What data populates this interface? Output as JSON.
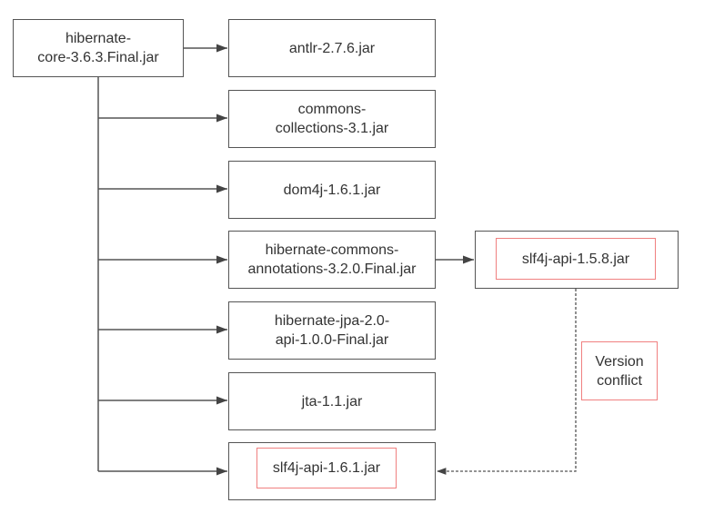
{
  "root": {
    "label_line1": "hibernate-",
    "label_line2": "core-3.6.3.Final.jar"
  },
  "dependencies": [
    {
      "line1": "antlr-2.7.6.jar",
      "line2": ""
    },
    {
      "line1": "commons-",
      "line2": "collections-3.1.jar"
    },
    {
      "line1": "dom4j-1.6.1.jar",
      "line2": ""
    },
    {
      "line1": "hibernate-commons-",
      "line2": "annotations-3.2.0.Final.jar"
    },
    {
      "line1": "hibernate-jpa-2.0-",
      "line2": "api-1.0.0-Final.jar"
    },
    {
      "line1": "jta-1.1.jar",
      "line2": ""
    },
    {
      "line1": "slf4j-api-1.6.1.jar",
      "line2": "",
      "highlighted": true
    }
  ],
  "transitive": {
    "label": "slf4j-api-1.5.8.jar",
    "highlighted": true
  },
  "conflict_note": {
    "line1": "Version",
    "line2": "conflict"
  },
  "colors": {
    "line": "#555555",
    "highlight": "#f08080",
    "text": "#333333"
  }
}
